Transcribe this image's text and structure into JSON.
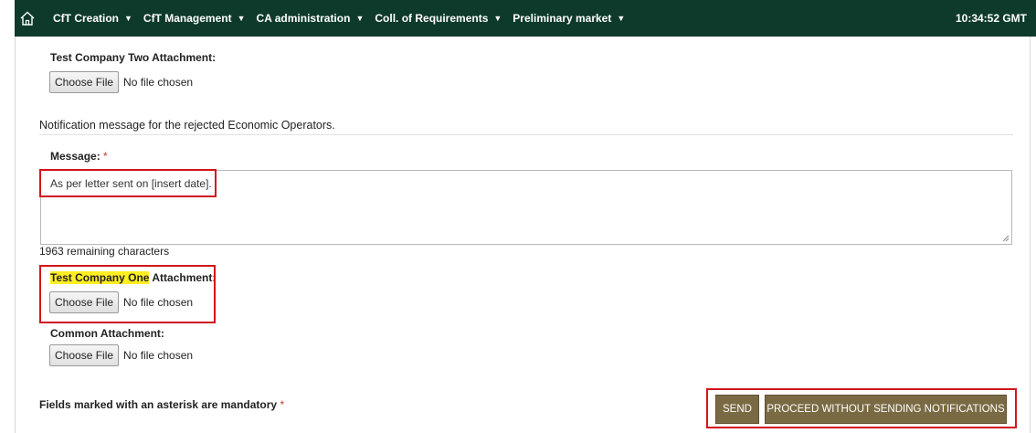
{
  "nav": {
    "items": [
      {
        "label": "CfT Creation"
      },
      {
        "label": "CfT Management"
      },
      {
        "label": "CA administration"
      },
      {
        "label": "Coll. of Requirements"
      },
      {
        "label": "Preliminary market"
      }
    ],
    "clock": "10:34:52 GMT"
  },
  "attachments": {
    "company_two": {
      "label": "Test Company Two Attachment:",
      "button": "Choose File",
      "status": "No file chosen"
    },
    "company_one": {
      "name_highlighted": "Test Company One",
      "label_rest": " Attachment:",
      "button": "Choose File",
      "status": "No file chosen"
    },
    "common": {
      "label": "Common Attachment:",
      "button": "Choose File",
      "status": "No file chosen"
    }
  },
  "notification": {
    "section_title": "Notification message for the rejected Economic Operators.",
    "message_label": "Message:",
    "required_mark": "*",
    "message_value": "As per letter sent on [insert date].",
    "remaining": "1963 remaining characters"
  },
  "footer": {
    "mandatory_text": "Fields marked with an asterisk are mandatory",
    "required_mark": "*",
    "send_label": "SEND",
    "proceed_label": "PROCEED WITHOUT SENDING NOTIFICATIONS"
  },
  "colors": {
    "topbar": "#0e3a2c",
    "button": "#7a6a44",
    "highlight_box": "#d0161b",
    "text_highlight": "#ffee22",
    "required": "#c0392b"
  },
  "icons": {
    "home": "home-icon",
    "menu_caret": "caret-down-icon",
    "resize": "resize-handle-icon"
  }
}
